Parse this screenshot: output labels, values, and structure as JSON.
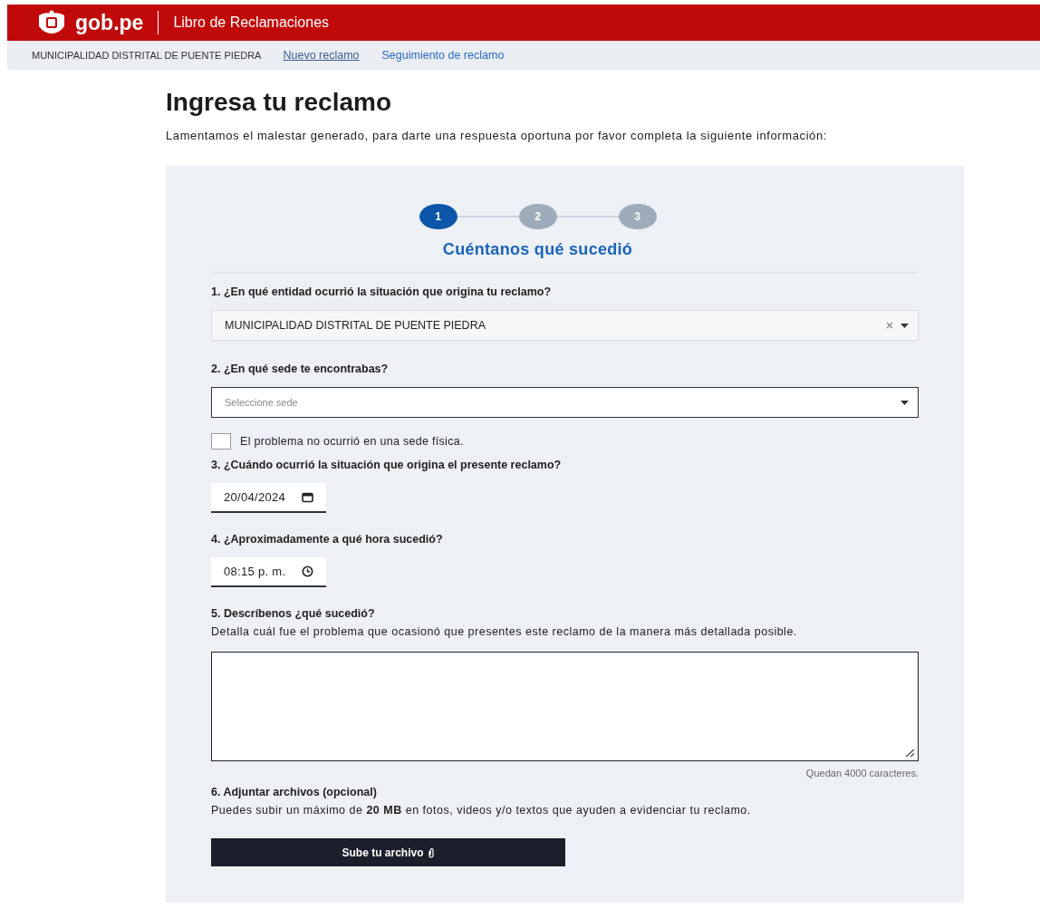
{
  "header": {
    "brand": "gob.pe",
    "title": "Libro de Reclamaciones"
  },
  "subnav": {
    "entity": "MUNICIPALIDAD DISTRITAL DE PUENTE PIEDRA",
    "links": [
      {
        "label": "Nuevo reclamo",
        "selected": true
      },
      {
        "label": "Seguimiento de reclamo",
        "selected": false
      }
    ]
  },
  "page": {
    "title": "Ingresa tu reclamo",
    "intro": "Lamentamos el malestar generado, para darte una respuesta oportuna por favor completa la siguiente información:"
  },
  "steps": [
    {
      "label": "1",
      "selected": true
    },
    {
      "label": "2",
      "selected": false
    },
    {
      "label": "3",
      "selected": false
    }
  ],
  "step_title": "Cuéntanos qué sucedió",
  "questions": [
    {
      "kind": "select",
      "label": "1. ¿En qué entidad ocurrió la situación que origina tu reclamo?",
      "value": "MUNICIPALIDAD DISTRITAL DE PUENTE PIEDRA",
      "clearable": true
    },
    {
      "kind": "select",
      "label": "2. ¿En qué sede te encontrabas?",
      "placeholder": "Seleccione sede",
      "clearable": false,
      "checkbox": {
        "label": "El problema no ocurrió en una sede física.",
        "checked": false
      }
    },
    {
      "kind": "date",
      "label": "3. ¿Cuándo ocurrió la situación que origina el presente reclamo?",
      "value": "20/04/2024"
    },
    {
      "kind": "time",
      "label": "4. ¿Aproximadamente a qué hora sucedió?",
      "value": "08:15 p. m."
    },
    {
      "kind": "textarea",
      "label": "5.  Descríbenos ¿qué sucedió?",
      "help": "Detalla cuál fue el problema que ocasionó que presentes este reclamo de la manera más detallada posible.",
      "counter": "Quedan 4000 caracteres."
    },
    {
      "kind": "upload",
      "label": "6.  Adjuntar archivos (opcional)",
      "help": "Puedes subir un máximo de **20 MB** en fotos, videos y/o textos que ayuden a evidenciar tu reclamo.",
      "button": "Sube tu archivo"
    }
  ]
}
